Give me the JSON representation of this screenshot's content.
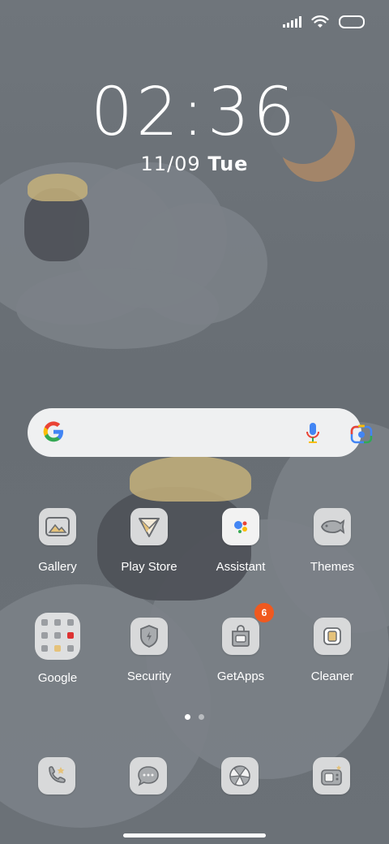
{
  "status_bar": {
    "signal_icon": "cellular-signal-icon",
    "wifi_icon": "wifi-icon",
    "battery_icon": "battery-icon"
  },
  "clock": {
    "time": "02:36",
    "date": "11/09",
    "day": "Tue"
  },
  "search_bar": {
    "logo_icon": "google-g-icon",
    "mic_icon": "microphone-icon",
    "lens_icon": "google-lens-icon"
  },
  "apps": [
    {
      "label": "Gallery",
      "icon": "gallery-icon"
    },
    {
      "label": "Play Store",
      "icon": "play-store-icon"
    },
    {
      "label": "Assistant",
      "icon": "assistant-icon"
    },
    {
      "label": "Themes",
      "icon": "themes-icon"
    },
    {
      "label": "Google",
      "icon": "google-folder-icon"
    },
    {
      "label": "Security",
      "icon": "security-icon"
    },
    {
      "label": "GetApps",
      "icon": "getapps-icon",
      "badge": "6"
    },
    {
      "label": "Cleaner",
      "icon": "cleaner-icon"
    }
  ],
  "page_indicator": {
    "pages": 2,
    "current": 1
  },
  "dock": [
    {
      "icon": "phone-icon"
    },
    {
      "icon": "messages-icon"
    },
    {
      "icon": "browser-icon"
    },
    {
      "icon": "camera-icon"
    }
  ],
  "colors": {
    "background": "#6c7278",
    "badge": "#f0591f",
    "moon": "#a78668",
    "icon_tile": "#d8d9da"
  }
}
